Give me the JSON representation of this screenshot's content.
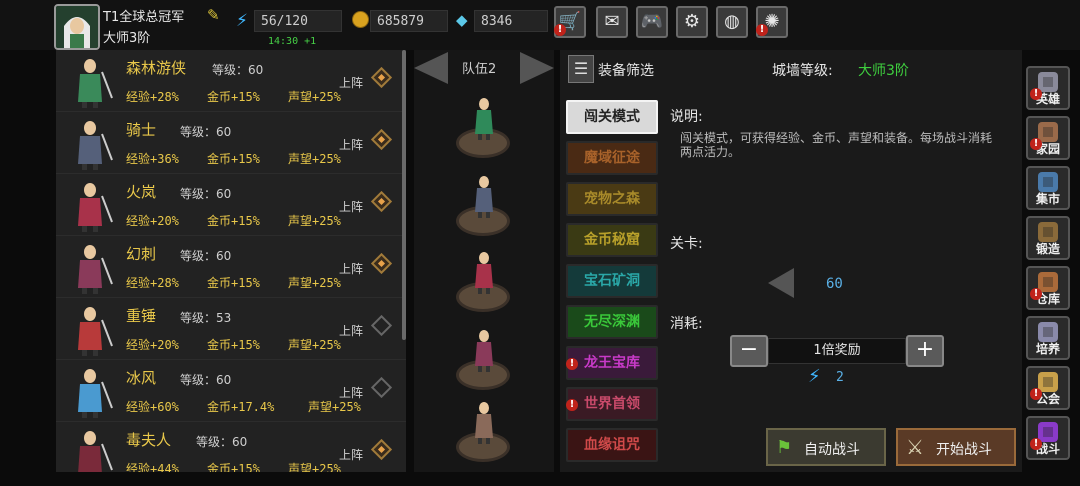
{
  "player": {
    "name": "T1全球总冠军",
    "rank": "大师3阶"
  },
  "resources": {
    "energy": "56/120",
    "energy_timer": "14:30 +1",
    "gold": "685879",
    "gems": "8346"
  },
  "top_buttons": [
    {
      "icon": "cart-icon",
      "glyph": "🛒",
      "alert": "!"
    },
    {
      "icon": "mail-icon",
      "glyph": "✉",
      "alert": ""
    },
    {
      "icon": "gamepad-icon",
      "glyph": "🎮",
      "alert": ""
    },
    {
      "icon": "gear-icon",
      "glyph": "⚙",
      "alert": ""
    },
    {
      "icon": "color-wheel-icon",
      "glyph": "◍",
      "alert": ""
    },
    {
      "icon": "fireworks-icon",
      "glyph": "✺",
      "alert": "!"
    }
  ],
  "heroes": [
    {
      "name": "森林游侠",
      "level": "等级：60",
      "exp": "经验+28%",
      "gold": "金币+15%",
      "fame": "声望+25%",
      "deploy": "上阵",
      "deployed": true,
      "color": "#3a8a5a"
    },
    {
      "name": "骑士",
      "level": "等级：60",
      "exp": "经验+36%",
      "gold": "金币+15%",
      "fame": "声望+25%",
      "deploy": "上阵",
      "deployed": true,
      "color": "#55607a"
    },
    {
      "name": "火岚",
      "level": "等级：60",
      "exp": "经验+20%",
      "gold": "金币+15%",
      "fame": "声望+25%",
      "deploy": "上阵",
      "deployed": true,
      "color": "#a8324a"
    },
    {
      "name": "幻刺",
      "level": "等级：60",
      "exp": "经验+28%",
      "gold": "金币+15%",
      "fame": "声望+25%",
      "deploy": "上阵",
      "deployed": true,
      "color": "#8a3a5a"
    },
    {
      "name": "重锤",
      "level": "等级：53",
      "exp": "经验+20%",
      "gold": "金币+15%",
      "fame": "声望+25%",
      "deploy": "上阵",
      "deployed": false,
      "color": "#b83a3a"
    },
    {
      "name": "冰风",
      "level": "等级：60",
      "exp": "经验+60%",
      "gold": "金币+17.4%",
      "fame": "声望+25%",
      "deploy": "上阵",
      "deployed": false,
      "color": "#4a9ad0"
    },
    {
      "name": "毒夫人",
      "level": "等级：60",
      "exp": "经验+44%",
      "gold": "金币+15%",
      "fame": "声望+25%",
      "deploy": "上阵",
      "deployed": true,
      "color": "#7a2a3a"
    }
  ],
  "team": {
    "label": "队伍2",
    "members": [
      "#2f8a5a",
      "#55607a",
      "#a8324a",
      "#8a3a5a",
      "#8a6a5a"
    ]
  },
  "filter": {
    "label": "装备筛选",
    "wall_label": "城墙等级:",
    "wall_value": "大师3阶"
  },
  "modes": [
    {
      "label": "闯关模式",
      "bg": "#d9d9d9",
      "fg": "#222222",
      "alert": ""
    },
    {
      "label": "魔域征途",
      "bg": "#4a2a14",
      "fg": "#a8622a",
      "alert": ""
    },
    {
      "label": "宠物之森",
      "bg": "#4a3a14",
      "fg": "#a88a2a",
      "alert": ""
    },
    {
      "label": "金币秘窟",
      "bg": "#3a3a14",
      "fg": "#b8a02a",
      "alert": ""
    },
    {
      "label": "宝石矿洞",
      "bg": "#143a3a",
      "fg": "#2aa8a8",
      "alert": ""
    },
    {
      "label": "无尽深渊",
      "bg": "#1a4a1a",
      "fg": "#3ac83a",
      "alert": ""
    },
    {
      "label": "龙王宝库",
      "bg": "#3a1a3a",
      "fg": "#c83ac8",
      "alert": "!"
    },
    {
      "label": "世界首领",
      "bg": "#3a1a24",
      "fg": "#c84a6a",
      "alert": "!"
    },
    {
      "label": "血缘诅咒",
      "bg": "#3a1414",
      "fg": "#d04a4a",
      "alert": ""
    }
  ],
  "description": {
    "title": "说明:",
    "text": "闯关模式，可获得经验、金币、声望和装备。每场战斗消耗两点活力。"
  },
  "stage": {
    "title": "关卡:",
    "value": "60"
  },
  "cost": {
    "title": "消耗:",
    "reward": "1倍奖励",
    "value": "2"
  },
  "actions": {
    "auto": "自动战斗",
    "start": "开始战斗"
  },
  "sidebar": [
    {
      "label": "英雄",
      "icon": "hero-helmet-icon",
      "color": "#8a8a9a",
      "alert": "!"
    },
    {
      "label": "家园",
      "icon": "castle-icon",
      "color": "#9a6a4a",
      "alert": "!"
    },
    {
      "label": "集市",
      "icon": "market-stall-icon",
      "color": "#4a7aaa",
      "alert": ""
    },
    {
      "label": "锻造",
      "icon": "anvil-hammer-icon",
      "color": "#8a6a3a",
      "alert": ""
    },
    {
      "label": "仓库",
      "icon": "storage-chest-icon",
      "color": "#aa6a3a",
      "alert": "!"
    },
    {
      "label": "培养",
      "icon": "trophy-icon",
      "color": "#8a8aaa",
      "alert": ""
    },
    {
      "label": "公会",
      "icon": "guild-emblem-icon",
      "color": "#c8a04a",
      "alert": "!"
    },
    {
      "label": "战斗",
      "icon": "portal-icon",
      "color": "#8a3ac8",
      "alert": "!"
    }
  ]
}
